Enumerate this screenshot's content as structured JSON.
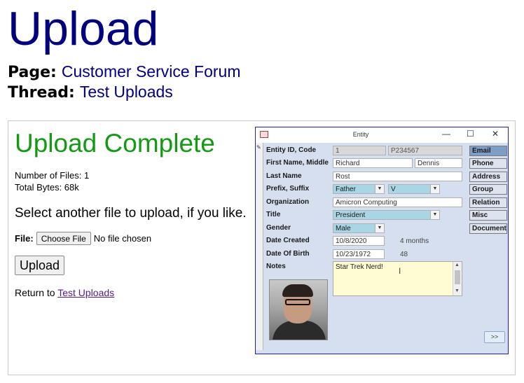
{
  "page": {
    "title": "Upload",
    "page_label": "Page:",
    "page_value": "Customer Service Forum",
    "thread_label": "Thread:",
    "thread_value": "Test Uploads"
  },
  "upload": {
    "heading": "Upload Complete",
    "files_line": "Number of Files: 1",
    "bytes_line": "Total Bytes: 68k",
    "prompt": "Select another file to upload, if you like.",
    "file_label": "File:",
    "choose_button": "Choose File",
    "no_file_text": "No file chosen",
    "upload_button": "Upload",
    "return_prefix": "Return to",
    "return_link": "Test Uploads"
  },
  "screenshot": {
    "window_title": "Entity",
    "controls": {
      "minimize": "—",
      "maximize": "☐",
      "close": "✕"
    },
    "fields": {
      "entity_label": "Entity ID, Code",
      "entity_id": "1",
      "entity_code": "P234567",
      "name_label": "First Name, Middle",
      "first_name": "Richard",
      "middle_name": "Dennis",
      "last_label": "Last Name",
      "last_name": "Rost",
      "prefix_label": "Prefix, Suffix",
      "prefix": "Father",
      "suffix": "V",
      "org_label": "Organization",
      "organization": "Amicron Computing",
      "title_label": "Title",
      "title": "President",
      "gender_label": "Gender",
      "gender": "Male",
      "created_label": "Date Created",
      "date_created": "10/8/2020",
      "created_age": "4 months",
      "dob_label": "Date Of Birth",
      "dob": "10/23/1972",
      "age": "48",
      "notes_label": "Notes",
      "notes": "Star Trek Nerd!"
    },
    "side_buttons": [
      "Email",
      "Phone",
      "Address",
      "Group",
      "Relation",
      "Misc",
      "Document"
    ],
    "nav_button": ">>"
  }
}
